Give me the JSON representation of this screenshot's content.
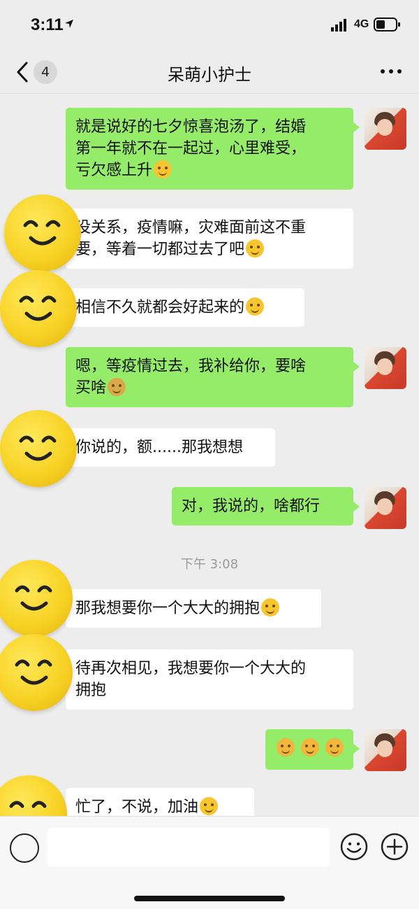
{
  "status_bar": {
    "time": "3:11",
    "network": "4G"
  },
  "header": {
    "unread_count": "4",
    "title": "呆萌小护士"
  },
  "messages": [
    {
      "lines": [
        "就是说好的七夕惊喜泡汤了，结婚",
        "第一年就不在一起过，心里难受，",
        "亏欠感上升"
      ]
    },
    {
      "lines": [
        "没关系，疫情嘛，灾难面前这不重",
        "要，等着一切都过去了吧"
      ]
    },
    {
      "lines": [
        "相信不久就都会好起来的"
      ]
    },
    {
      "lines": [
        "嗯，等疫情过去，我补给你，要啥",
        "买啥"
      ]
    },
    {
      "lines": [
        "你说的，额......那我想想"
      ]
    },
    {
      "lines": [
        "对，我说的，啥都行"
      ]
    },
    {
      "lines": [
        "那我想要你一个大大的拥抱"
      ]
    },
    {
      "lines": [
        "待再次相见，我想要你一个大大的",
        "拥抱"
      ]
    },
    {
      "lines": [
        ""
      ]
    },
    {
      "lines": [
        "忙了，不说，加油"
      ]
    }
  ],
  "time_separator": "下午 3:08",
  "colors": {
    "outgoing_bubble": "#95ec69",
    "incoming_bubble": "#ffffff",
    "background": "#ededed"
  },
  "icons": [
    "back-arrow-icon",
    "more-icon",
    "voice-icon",
    "emoji-icon",
    "plus-icon",
    "smiley-avatar-icon"
  ]
}
